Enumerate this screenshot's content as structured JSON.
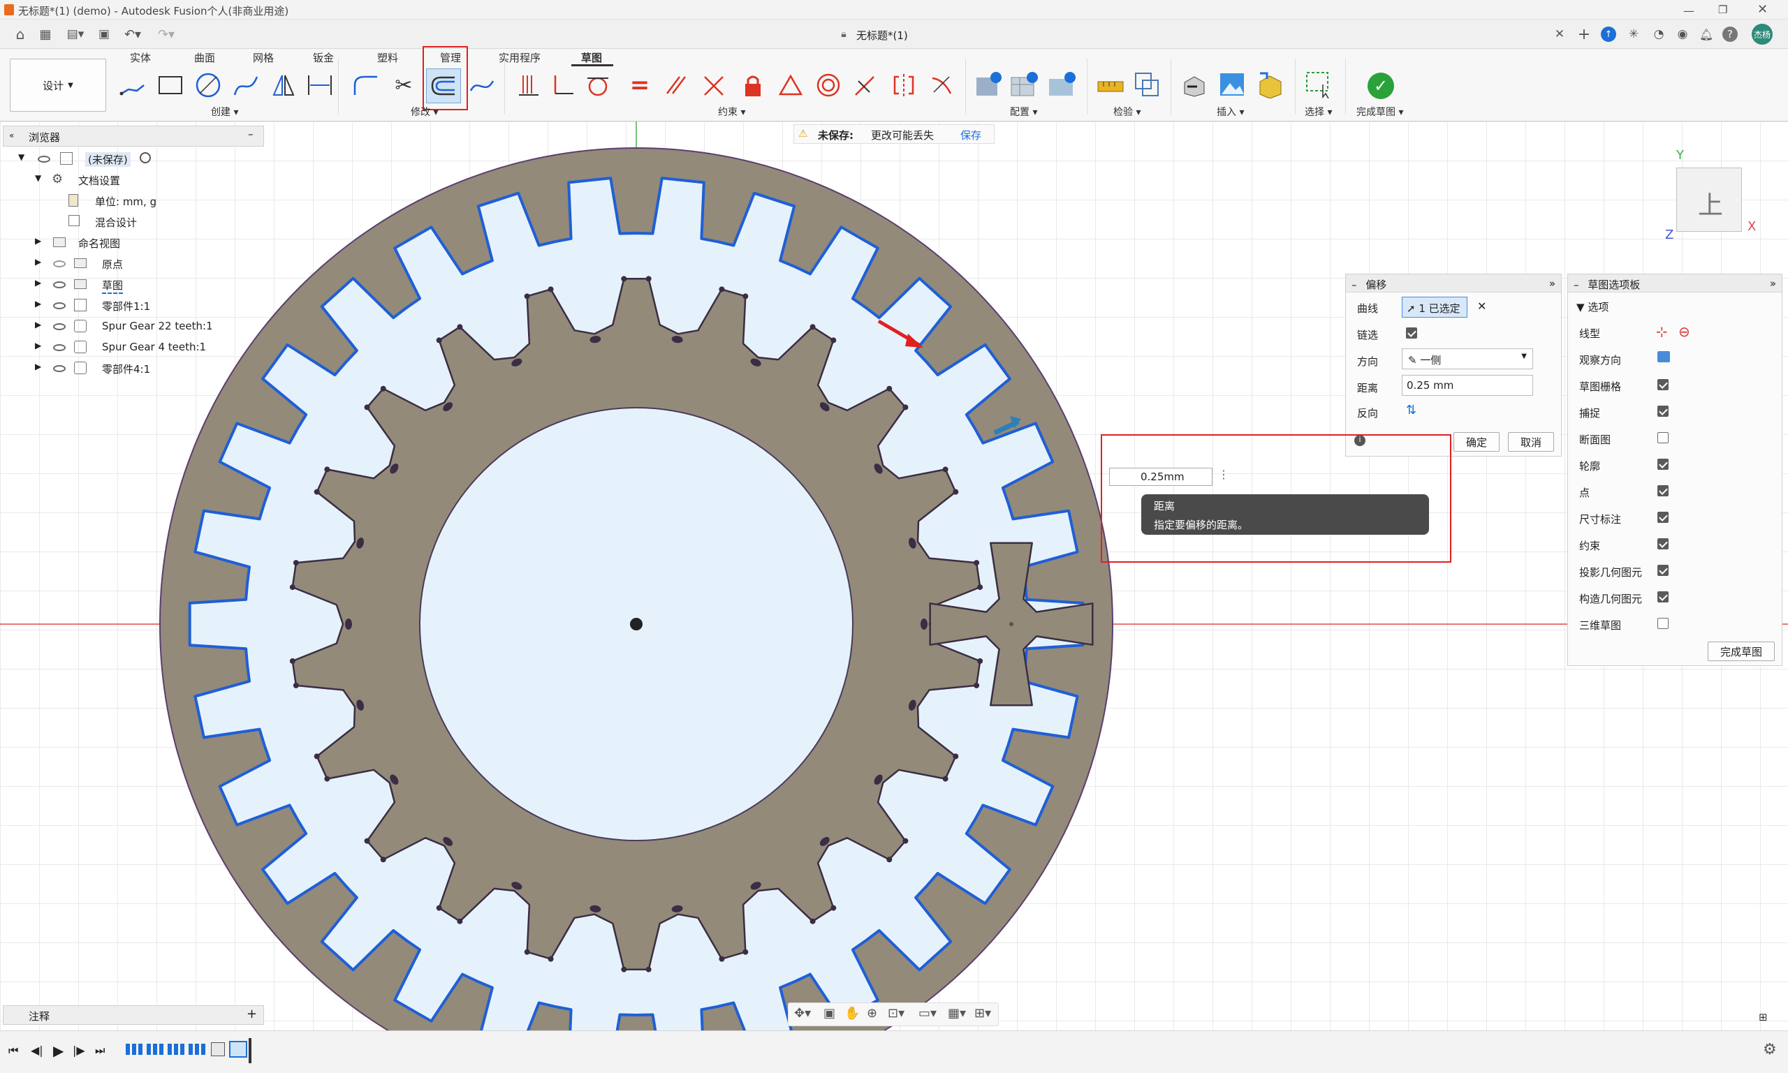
{
  "window": {
    "title": "无标题*(1) (demo) - Autodesk Fusion个人(非商业用途)"
  },
  "doc_tab": {
    "title": "无标题*(1)"
  },
  "design_button": "设计",
  "ribbon_tabs": [
    "实体",
    "曲面",
    "网格",
    "钣金",
    "塑料",
    "管理",
    "实用程序",
    "草图"
  ],
  "groups": {
    "create": "创建",
    "modify": "修改",
    "constraint": "约束",
    "config": "配置",
    "inspect": "检验",
    "insert": "插入",
    "select": "选择",
    "finish": "完成草图"
  },
  "unsaved": {
    "label": "未保存:",
    "msg": "更改可能丢失",
    "save": "保存"
  },
  "browser": {
    "title": "浏览器",
    "root": "(未保存)",
    "doc_settings": "文档设置",
    "units": "单位: mm, g",
    "hybrid": "混合设计",
    "named_views": "命名视图",
    "origin": "原点",
    "sketch": "草图",
    "comp1": "零部件1:1",
    "gear22": "Spur Gear 22 teeth:1",
    "gear4": "Spur Gear 4 teeth:1",
    "comp4": "零部件4:1"
  },
  "annotations": "注释",
  "offset": {
    "title": "偏移",
    "curve_label": "曲线",
    "curve_value": "1 已选定",
    "chain_label": "链选",
    "direction_label": "方向",
    "direction_value": "一侧",
    "distance_label": "距离",
    "distance_value": "0.25 mm",
    "flip_label": "反向",
    "ok": "确定",
    "cancel": "取消"
  },
  "input": {
    "value": "0.25mm"
  },
  "tooltip": {
    "title": "距离",
    "desc": "指定要偏移的距离。"
  },
  "sketch_palette": {
    "title": "草图选项板",
    "section": "选项",
    "linetype": "线型",
    "look_at": "观察方向",
    "grid": "草图栅格",
    "snap": "捕捉",
    "slice": "断面图",
    "profile": "轮廓",
    "points": "点",
    "dims": "尺寸标注",
    "constraints": "约束",
    "proj_geom": "投影几何图元",
    "constr_geom": "构造几何图元",
    "sketch3d": "三维草图",
    "finish": "完成草图"
  },
  "palette_checks": {
    "grid": true,
    "snap": true,
    "slice": false,
    "profile": true,
    "points": true,
    "dims": true,
    "constraints": true,
    "proj_geom": true,
    "constr_geom": true,
    "sketch3d": false
  },
  "viewcube": {
    "face": "上",
    "x": "X",
    "y": "Y",
    "z": "Z"
  },
  "avatar": "杰杨",
  "colors": {
    "gear": "#938a7a",
    "sketch_blue": "#1f5fd6",
    "fill": "#e6f2fb",
    "highlight_red": "#e02020"
  }
}
